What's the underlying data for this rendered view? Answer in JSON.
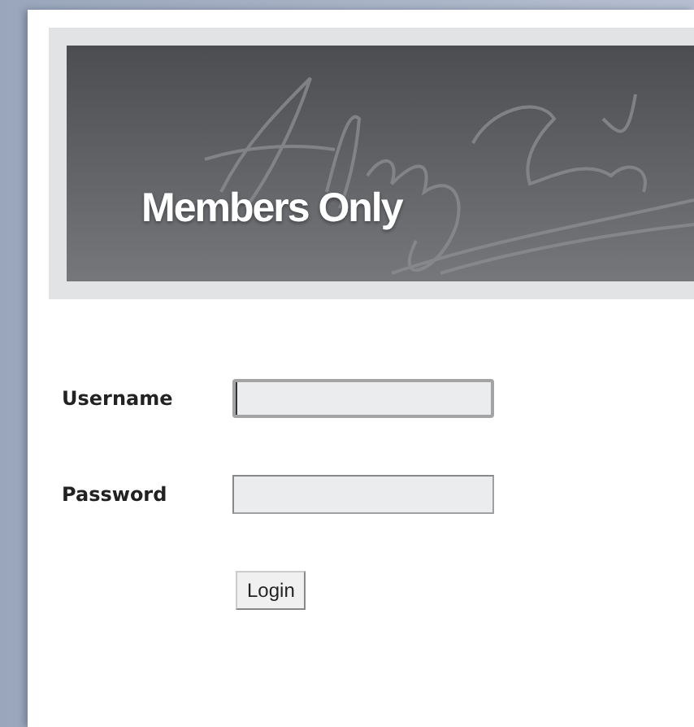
{
  "banner": {
    "title": "Members Only"
  },
  "form": {
    "fields": [
      {
        "label": "Username",
        "focused": true
      },
      {
        "label": "Password",
        "focused": false
      }
    ],
    "button": "Login"
  }
}
